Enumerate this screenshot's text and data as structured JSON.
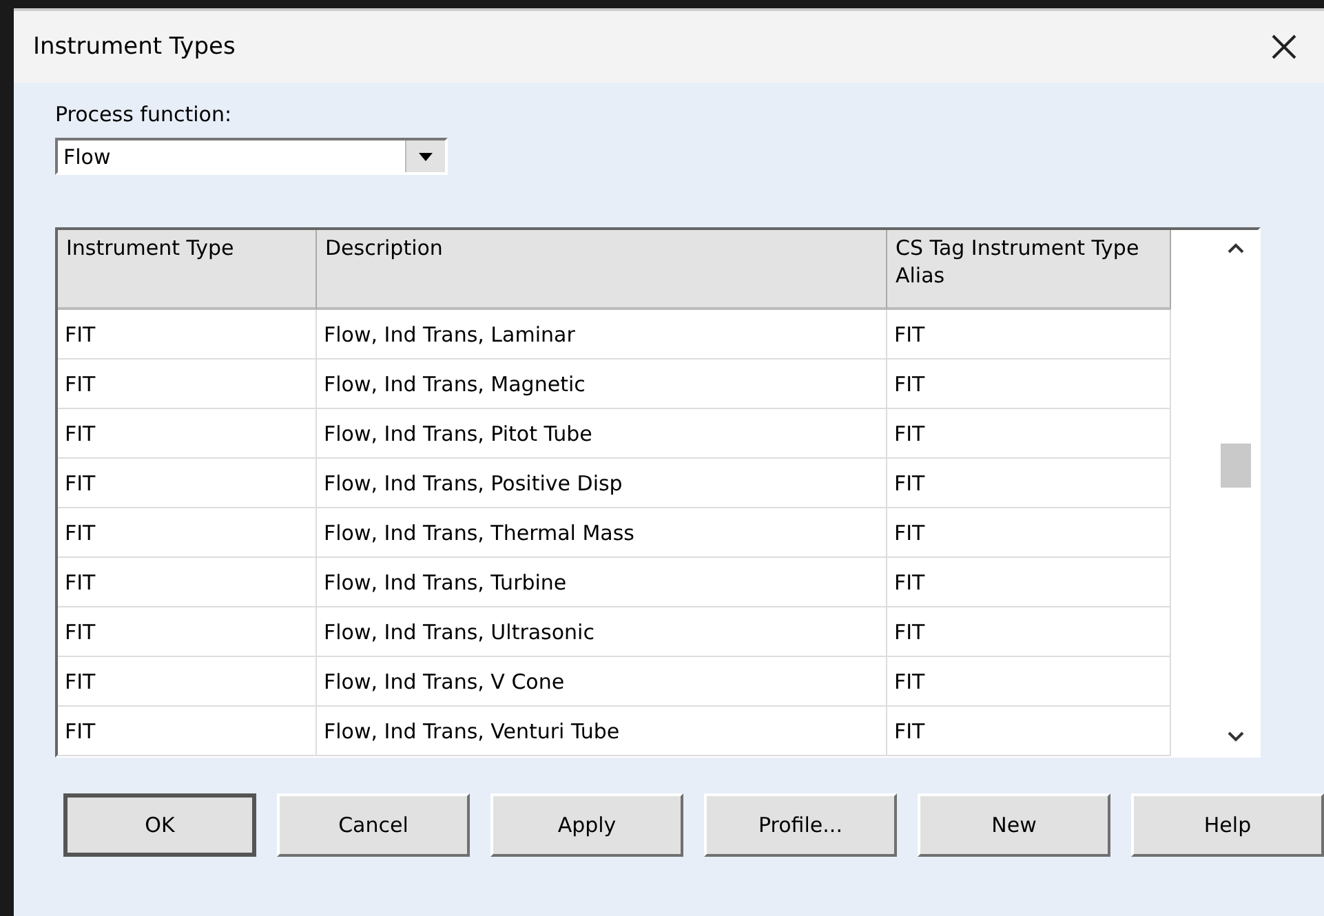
{
  "window": {
    "title": "Instrument Types"
  },
  "process_function": {
    "label": "Process function:",
    "value": "Flow"
  },
  "table": {
    "columns": [
      "Instrument Type",
      "Description",
      "CS Tag Instrument Type Alias"
    ],
    "rows": [
      [
        "FIT",
        "Flow, Ind Trans, Laminar",
        "FIT"
      ],
      [
        "FIT",
        "Flow, Ind Trans, Magnetic",
        "FIT"
      ],
      [
        "FIT",
        "Flow, Ind Trans, Pitot Tube",
        "FIT"
      ],
      [
        "FIT",
        "Flow, Ind Trans, Positive Disp",
        "FIT"
      ],
      [
        "FIT",
        "Flow, Ind Trans, Thermal Mass",
        "FIT"
      ],
      [
        "FIT",
        "Flow, Ind Trans, Turbine",
        "FIT"
      ],
      [
        "FIT",
        "Flow, Ind Trans, Ultrasonic",
        "FIT"
      ],
      [
        "FIT",
        "Flow, Ind Trans, V Cone",
        "FIT"
      ],
      [
        "FIT",
        "Flow, Ind Trans, Venturi Tube",
        "FIT"
      ]
    ]
  },
  "buttons": [
    {
      "label": "OK",
      "default": true
    },
    {
      "label": "Cancel",
      "default": false
    },
    {
      "label": "Apply",
      "default": false
    },
    {
      "label": "Profile...",
      "default": false
    },
    {
      "label": "New",
      "default": false
    },
    {
      "label": "Help",
      "default": false
    }
  ]
}
